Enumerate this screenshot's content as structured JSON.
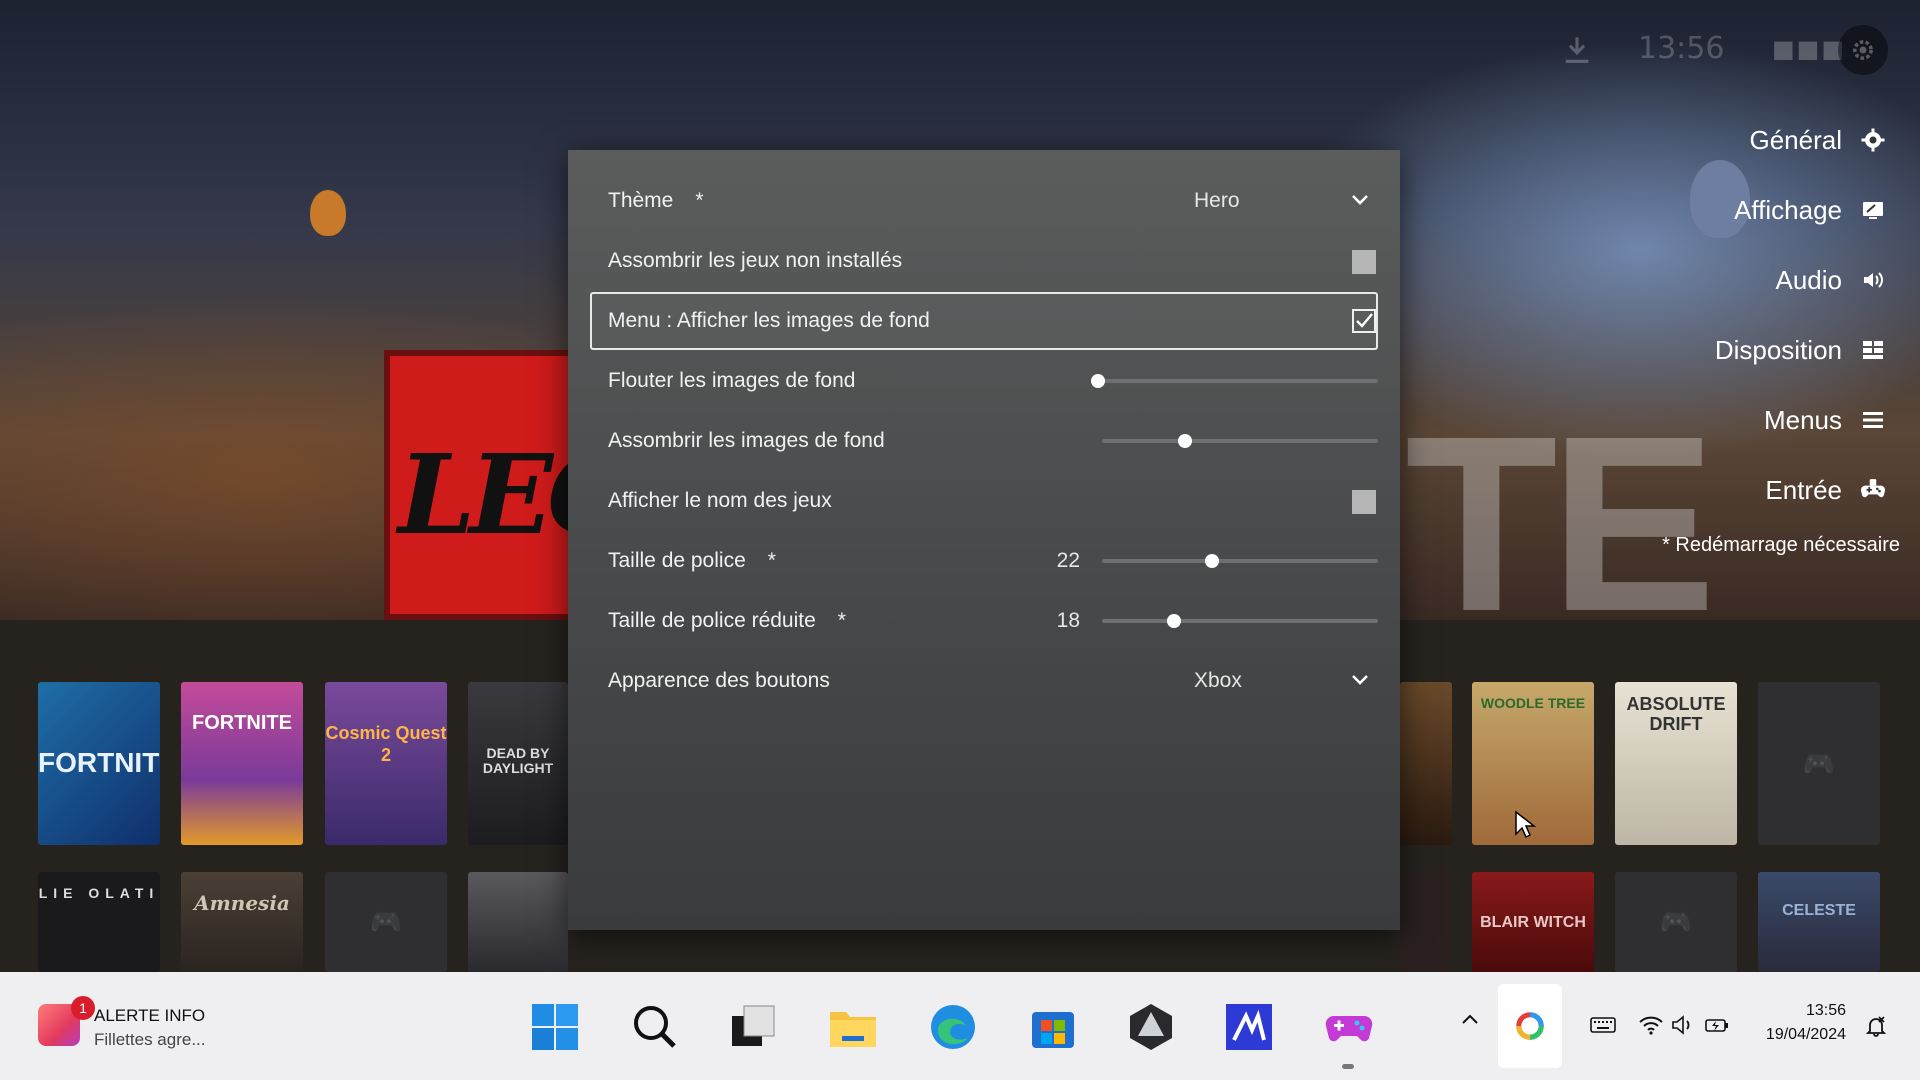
{
  "top_status": {
    "time": "13:56"
  },
  "right_menu": {
    "items": [
      {
        "label": "Général",
        "icon": "gear-icon"
      },
      {
        "label": "Affichage",
        "icon": "display-icon"
      },
      {
        "label": "Audio",
        "icon": "speaker-icon"
      },
      {
        "label": "Disposition",
        "icon": "grid-icon"
      },
      {
        "label": "Menus",
        "icon": "menu-lines-icon"
      },
      {
        "label": "Entrée",
        "icon": "gamepad-icon"
      }
    ],
    "restart_note": "* Redémarrage nécessaire"
  },
  "settings": {
    "theme": {
      "label": "Thème",
      "star": "*",
      "value": "Hero"
    },
    "dim_uninstalled": {
      "label": "Assombrir les jeux non installés",
      "checked": false
    },
    "menu_backgrounds": {
      "label": "Menu : Afficher les images de fond",
      "checked": true
    },
    "blur_backgrounds": {
      "label": "Flouter les images de fond",
      "level": 0
    },
    "darken_backgrounds": {
      "label": "Assombrir les images de fond",
      "level": 0.3
    },
    "show_game_names": {
      "label": "Afficher le nom des jeux",
      "checked": false
    },
    "font_size": {
      "label": "Taille de police",
      "star": "*",
      "value": "22",
      "level": 0.4
    },
    "font_size_small": {
      "label": "Taille de police réduite",
      "star": "*",
      "value": "18",
      "level": 0.26
    },
    "button_style": {
      "label": "Apparence des boutons",
      "value": "Xbox"
    }
  },
  "library_tiles": {
    "row1": [
      "FORTNITE",
      "FORTNITE",
      "Cosmic Quest 2",
      "DEAD BY DAYLIGHT",
      "",
      "WOODLE TREE",
      "ABSOLUTE DRIFT",
      ""
    ],
    "row2": [
      "LIE OLATI",
      "Amnesia",
      "",
      "",
      "",
      "BLAIR WITCH",
      "",
      "CELESTE"
    ]
  },
  "taskbar": {
    "news_title": "ALERTE INFO",
    "news_sub": "Fillettes agre...",
    "news_badge": "1",
    "time": "13:56",
    "date": "19/04/2024"
  },
  "colors": {
    "panel_bg": "#4e4f50",
    "accent_white": "#ffffff",
    "taskbar_bg": "#efeff2"
  }
}
